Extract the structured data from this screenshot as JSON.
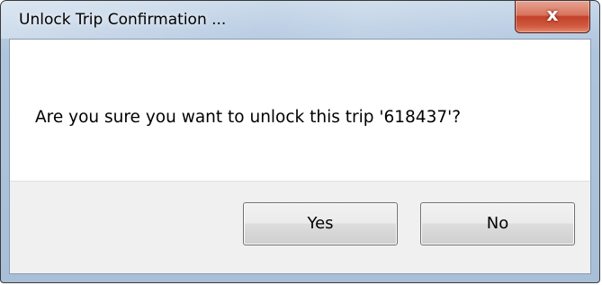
{
  "window": {
    "title": "Unlock Trip Confirmation ...",
    "close_glyph": "x"
  },
  "dialog": {
    "message": "Are you sure you want to unlock this trip '618437'?",
    "buttons": {
      "yes_label": "Yes",
      "no_label": "No"
    }
  },
  "icons": {
    "close": "close-icon"
  },
  "colors": {
    "frame": "#b9cde3",
    "close_button": "#c2412a",
    "button_area": "#f0f0f0"
  }
}
